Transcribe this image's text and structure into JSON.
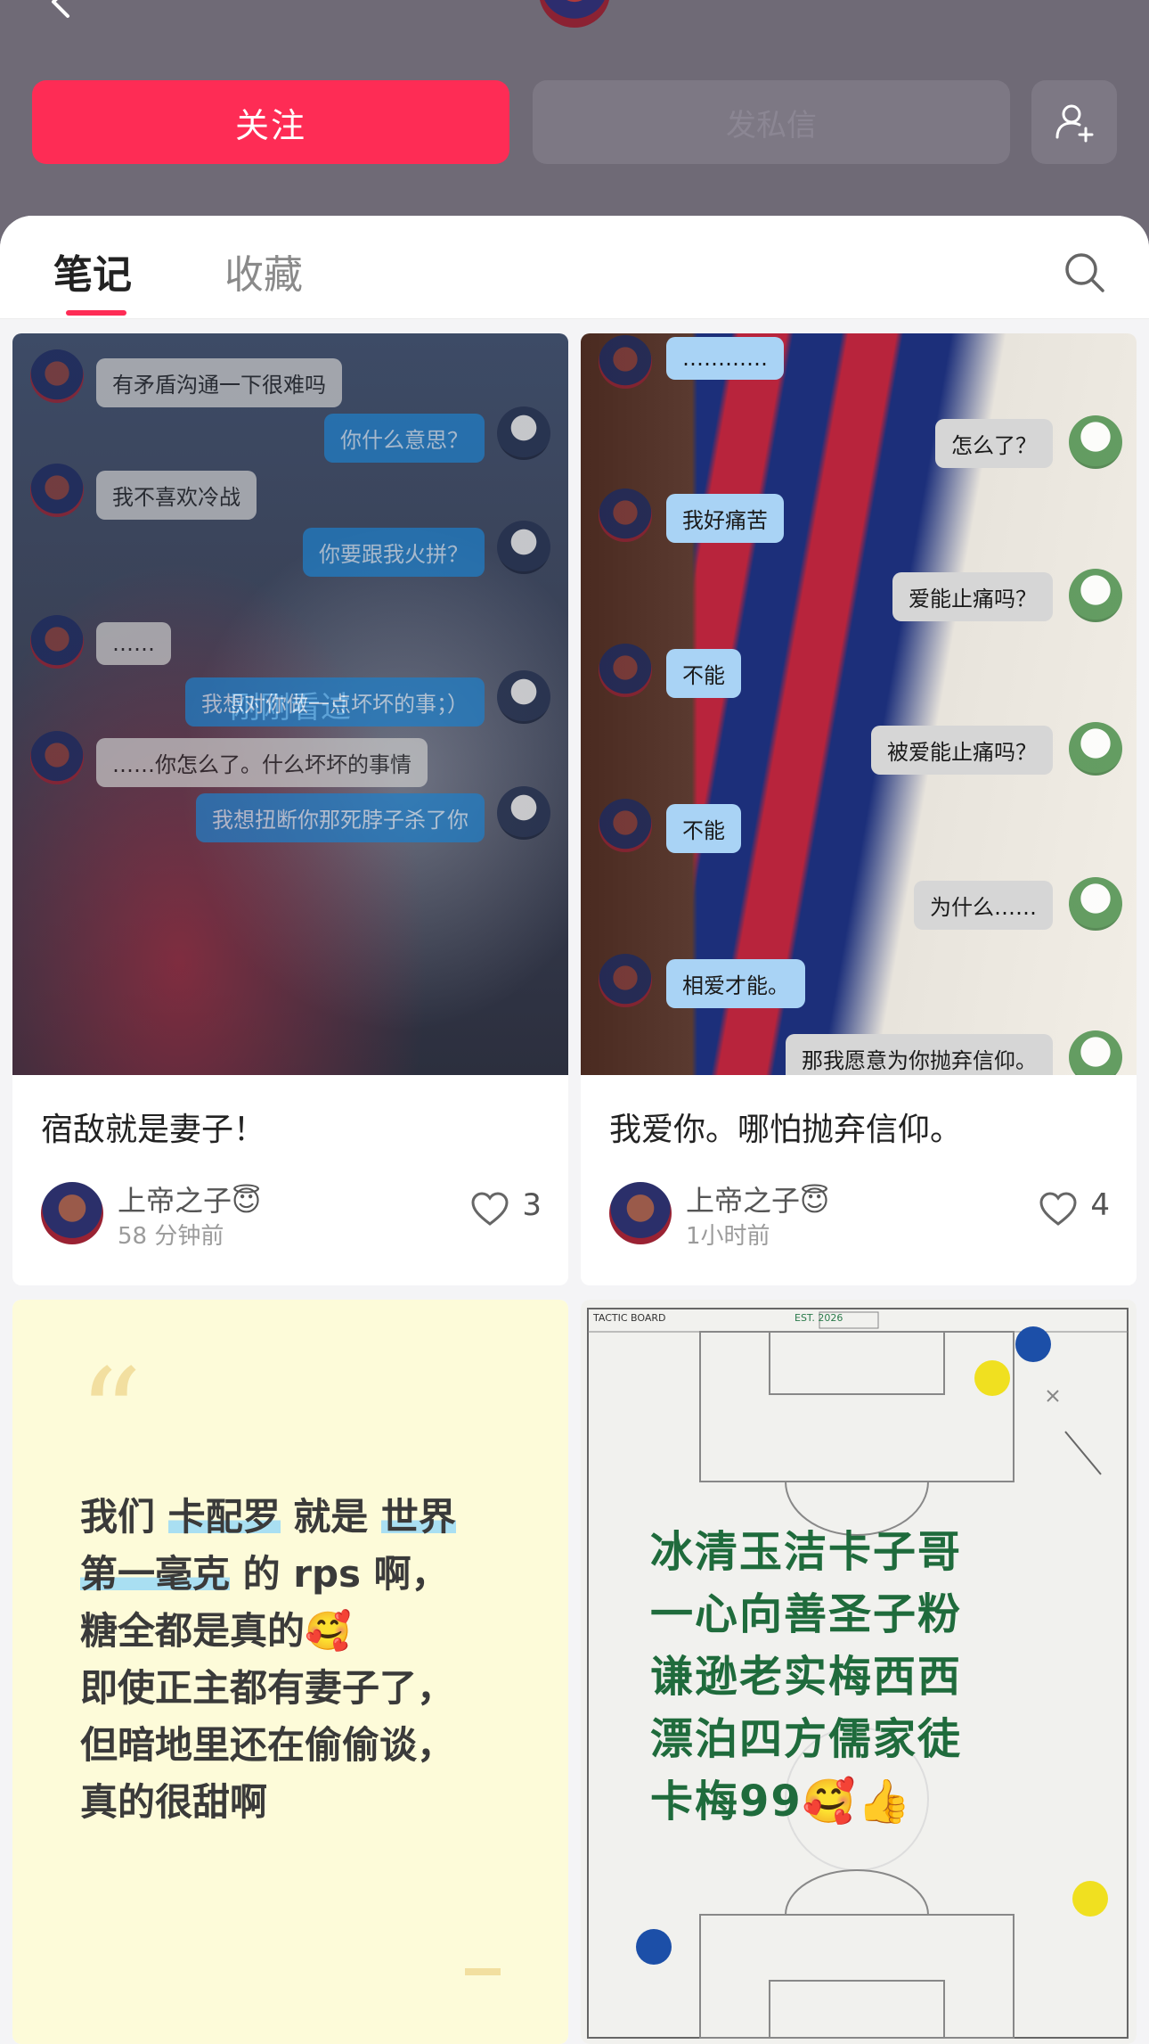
{
  "header": {
    "follow_label": "关注",
    "message_label": "发私信"
  },
  "tabs": [
    {
      "label": "笔记",
      "active": true
    },
    {
      "label": "收藏",
      "active": false
    }
  ],
  "colors": {
    "accent": "#fe2c55",
    "header_bg": "#6f6a76",
    "board_green": "#1f6b3c"
  },
  "notes": [
    {
      "title": "宿敌就是妻子！",
      "author": "上帝之子😇",
      "time": "58 分钟前",
      "likes": "3",
      "overlay": "刚刚看过",
      "chat": [
        "有矛盾沟通一下很难吗",
        "你什么意思？",
        "我不喜欢冷战",
        "你要跟我火拼？",
        "……",
        "我想对你做一点坏坏的事；）",
        "……你怎么了。什么坏坏的事情",
        "我想扭断你那死脖子杀了你"
      ]
    },
    {
      "title": "我爱你。哪怕抛弃信仰。",
      "author": "上帝之子😇",
      "time": "1小时前",
      "likes": "4",
      "chat": [
        "…………",
        "怎么了？",
        "我好痛苦",
        "爱能止痛吗？",
        "不能",
        "被爱能止痛吗？",
        "不能",
        "为什么……",
        "相爱才能。",
        "那我愿意为你抛弃信仰。"
      ]
    },
    {
      "quote_mark": "“",
      "quote_lines": [
        [
          "我们",
          "卡配罗",
          "就是",
          "世界"
        ],
        [
          "第一毫克",
          "的 rps 啊，"
        ],
        [
          "糖全都是真的🥰"
        ],
        [
          "即使正主都有妻子了，"
        ],
        [
          "但暗地里还在偷偷谈，"
        ],
        [
          "真的很甜啊"
        ]
      ]
    },
    {
      "board_header": "TACTIC BOARD",
      "board_est": "EST. 2026",
      "board_lines": [
        "冰清玉洁卡子哥",
        "一心向善圣子粉",
        "谦逊老实梅西西",
        "漂泊四方儒家徒",
        "卡梅99🥰👍"
      ]
    }
  ]
}
